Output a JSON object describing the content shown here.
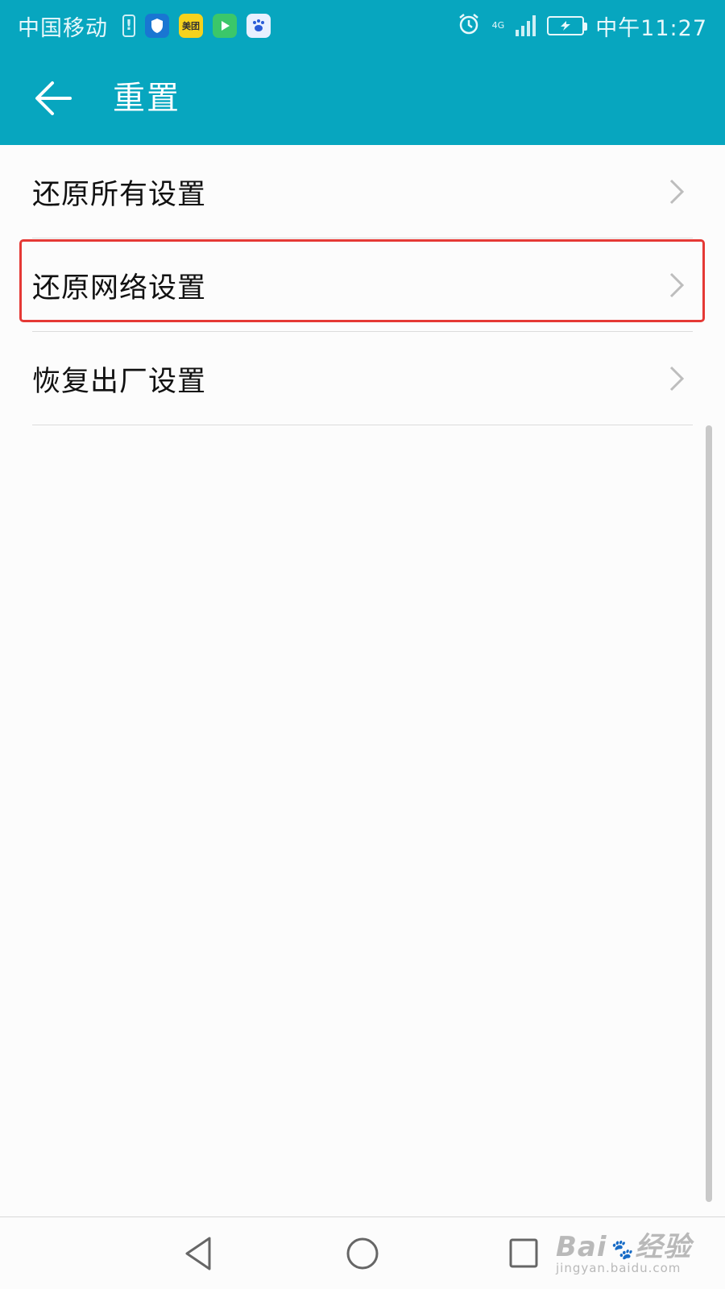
{
  "status_bar": {
    "carrier": "中国移动",
    "meituan_badge": "美团",
    "network": "4G",
    "time": "中午11:27"
  },
  "app_bar": {
    "title": "重置"
  },
  "list": {
    "items": [
      {
        "label": "还原所有设置"
      },
      {
        "label": "还原网络设置"
      },
      {
        "label": "恢复出厂设置"
      }
    ]
  },
  "watermark": {
    "logo_prefix": "Bai",
    "logo_suffix": "经验",
    "url": "jingyan.baidu.com"
  },
  "colors": {
    "accent": "#07a6bf",
    "highlight": "#e53935"
  }
}
